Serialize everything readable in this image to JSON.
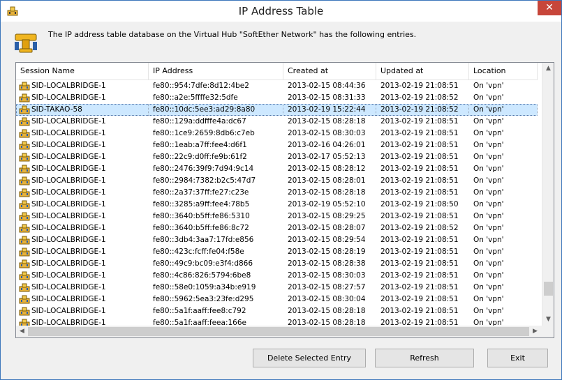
{
  "window": {
    "title": "IP Address Table",
    "close_glyph": "✕",
    "icon": "network-hub-icon"
  },
  "description": "The IP address table database on the Virtual Hub \"SoftEther Network\" has the following entries.",
  "table": {
    "columns": [
      "Session Name",
      "IP Address",
      "Created at",
      "Updated at",
      "Location"
    ],
    "selected_index": 2,
    "rows": [
      {
        "session": "SID-LOCALBRIDGE-1",
        "ip": "fe80::954:7dfe:8d12:4be2",
        "created": "2013-02-15 08:44:36",
        "updated": "2013-02-19 21:08:51",
        "location": "On 'vpn'"
      },
      {
        "session": "SID-LOCALBRIDGE-1",
        "ip": "fe80::a2e:5ffffe32:5dfe",
        "created": "2013-02-15 08:31:33",
        "updated": "2013-02-19 21:08:52",
        "location": "On 'vpn'"
      },
      {
        "session": "SID-TAKAO-58",
        "ip": "fe80::10dc:5ee3:ad29:8a80",
        "created": "2013-02-19 15:22:44",
        "updated": "2013-02-19 21:08:52",
        "location": "On 'vpn'"
      },
      {
        "session": "SID-LOCALBRIDGE-1",
        "ip": "fe80::129a:ddfffe4a:dc67",
        "created": "2013-02-15 08:28:18",
        "updated": "2013-02-19 21:08:51",
        "location": "On 'vpn'"
      },
      {
        "session": "SID-LOCALBRIDGE-1",
        "ip": "fe80::1ce9:2659:8db6:c7eb",
        "created": "2013-02-15 08:30:03",
        "updated": "2013-02-19 21:08:51",
        "location": "On 'vpn'"
      },
      {
        "session": "SID-LOCALBRIDGE-1",
        "ip": "fe80::1eab:a7ff:fee4:d6f1",
        "created": "2013-02-16 04:26:01",
        "updated": "2013-02-19 21:08:51",
        "location": "On 'vpn'"
      },
      {
        "session": "SID-LOCALBRIDGE-1",
        "ip": "fe80::22c9:d0ff:fe9b:61f2",
        "created": "2013-02-17 05:52:13",
        "updated": "2013-02-19 21:08:51",
        "location": "On 'vpn'"
      },
      {
        "session": "SID-LOCALBRIDGE-1",
        "ip": "fe80::2476:39f9:7d94:9c14",
        "created": "2013-02-15 08:28:12",
        "updated": "2013-02-19 21:08:51",
        "location": "On 'vpn'"
      },
      {
        "session": "SID-LOCALBRIDGE-1",
        "ip": "fe80::2984:7382:b2c5:47d7",
        "created": "2013-02-15 08:28:01",
        "updated": "2013-02-19 21:08:51",
        "location": "On 'vpn'"
      },
      {
        "session": "SID-LOCALBRIDGE-1",
        "ip": "fe80::2a37:37ff:fe27:c23e",
        "created": "2013-02-15 08:28:18",
        "updated": "2013-02-19 21:08:51",
        "location": "On 'vpn'"
      },
      {
        "session": "SID-LOCALBRIDGE-1",
        "ip": "fe80::3285:a9ff:fee4:78b5",
        "created": "2013-02-19 05:52:10",
        "updated": "2013-02-19 21:08:50",
        "location": "On 'vpn'"
      },
      {
        "session": "SID-LOCALBRIDGE-1",
        "ip": "fe80::3640:b5ff:fe86:5310",
        "created": "2013-02-15 08:29:25",
        "updated": "2013-02-19 21:08:51",
        "location": "On 'vpn'"
      },
      {
        "session": "SID-LOCALBRIDGE-1",
        "ip": "fe80::3640:b5ff:fe86:8c72",
        "created": "2013-02-15 08:28:07",
        "updated": "2013-02-19 21:08:52",
        "location": "On 'vpn'"
      },
      {
        "session": "SID-LOCALBRIDGE-1",
        "ip": "fe80::3db4:3aa7:17fd:e856",
        "created": "2013-02-15 08:29:54",
        "updated": "2013-02-19 21:08:51",
        "location": "On 'vpn'"
      },
      {
        "session": "SID-LOCALBRIDGE-1",
        "ip": "fe80::423c:fcff:fe04:f58e",
        "created": "2013-02-15 08:28:19",
        "updated": "2013-02-19 21:08:51",
        "location": "On 'vpn'"
      },
      {
        "session": "SID-LOCALBRIDGE-1",
        "ip": "fe80::49c9:bc09:e3f4:d866",
        "created": "2013-02-15 08:28:38",
        "updated": "2013-02-19 21:08:51",
        "location": "On 'vpn'"
      },
      {
        "session": "SID-LOCALBRIDGE-1",
        "ip": "fe80::4c86:826:5794:6be8",
        "created": "2013-02-15 08:30:03",
        "updated": "2013-02-19 21:08:51",
        "location": "On 'vpn'"
      },
      {
        "session": "SID-LOCALBRIDGE-1",
        "ip": "fe80::58e0:1059:a34b:e919",
        "created": "2013-02-15 08:27:57",
        "updated": "2013-02-19 21:08:51",
        "location": "On 'vpn'"
      },
      {
        "session": "SID-LOCALBRIDGE-1",
        "ip": "fe80::5962:5ea3:23fe:d295",
        "created": "2013-02-15 08:30:04",
        "updated": "2013-02-19 21:08:51",
        "location": "On 'vpn'"
      },
      {
        "session": "SID-LOCALBRIDGE-1",
        "ip": "fe80::5a1f:aaff:fee8:c792",
        "created": "2013-02-15 08:28:18",
        "updated": "2013-02-19 21:08:51",
        "location": "On 'vpn'"
      },
      {
        "session": "SID-LOCALBRIDGE-1",
        "ip": "fe80::5a1f:aaff:feea:166e",
        "created": "2013-02-15 08:28:18",
        "updated": "2013-02-19 21:08:51",
        "location": "On 'vpn'"
      }
    ]
  },
  "scrollbar": {
    "up_glyph": "▲",
    "down_glyph": "▼",
    "left_glyph": "◀",
    "right_glyph": "▶"
  },
  "buttons": {
    "delete": "Delete Selected Entry",
    "refresh": "Refresh",
    "exit": "Exit"
  },
  "colors": {
    "selection": "#cde8ff",
    "close_button": "#c7463a",
    "window_border": "#3c76bb"
  }
}
